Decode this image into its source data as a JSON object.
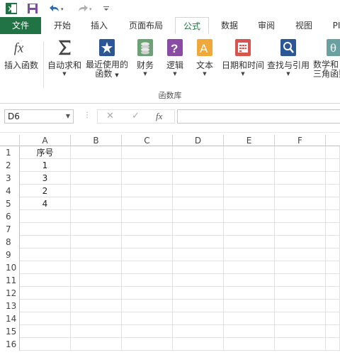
{
  "quick_access": {
    "excel_icon": "excel-icon",
    "save_icon": "save-icon",
    "undo_icon": "undo-icon",
    "redo_icon": "redo-icon",
    "customize_icon": "customize-icon"
  },
  "tabs": [
    {
      "label": "文件"
    },
    {
      "label": "开始"
    },
    {
      "label": "插入"
    },
    {
      "label": "页面布局"
    },
    {
      "label": "公式"
    },
    {
      "label": "数据"
    },
    {
      "label": "审阅"
    },
    {
      "label": "视图"
    },
    {
      "label": "PI"
    }
  ],
  "ribbon": {
    "buttons": [
      {
        "label": "插入函数",
        "icon": "fx-icon"
      },
      {
        "label": "自动求和",
        "icon": "sigma-icon"
      },
      {
        "label": "最近使用的",
        "label2": "函数",
        "icon": "star-book-icon"
      },
      {
        "label": "财务",
        "icon": "coins-book-icon"
      },
      {
        "label": "逻辑",
        "icon": "question-book-icon"
      },
      {
        "label": "文本",
        "icon": "text-book-icon"
      },
      {
        "label": "日期和时间",
        "icon": "calendar-book-icon"
      },
      {
        "label": "查找与引用",
        "icon": "magnifier-book-icon"
      },
      {
        "label": "数学和",
        "label2": "三角函数",
        "icon": "theta-book-icon"
      }
    ],
    "group_label": "函数库"
  },
  "formula_bar": {
    "name_box": "D6",
    "cancel": "✕",
    "enter": "✓",
    "fx": "fx",
    "value": ""
  },
  "sheet": {
    "columns": [
      "A",
      "B",
      "C",
      "D",
      "E",
      "F"
    ],
    "rows": [
      "1",
      "2",
      "3",
      "4",
      "5",
      "6",
      "7",
      "8",
      "9",
      "10",
      "11",
      "12",
      "13",
      "14",
      "15",
      "16"
    ],
    "col_a": [
      "序号",
      "1",
      "3",
      "2",
      "4"
    ]
  },
  "colors": {
    "excel_green": "#217346"
  }
}
